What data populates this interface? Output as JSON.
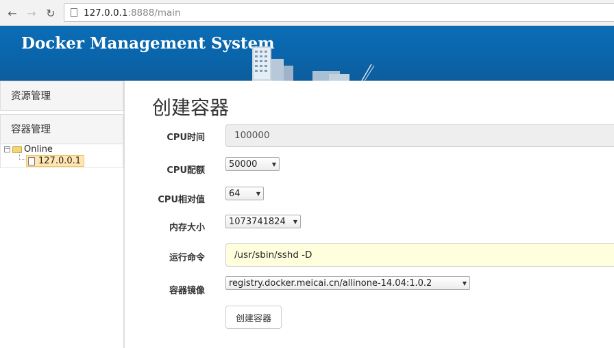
{
  "browser": {
    "url_host": "127.0.0.1",
    "url_rest": ":8888/main"
  },
  "banner": {
    "title": "Docker Management System"
  },
  "sidebar": {
    "sections": [
      {
        "label": "资源管理"
      },
      {
        "label": "容器管理"
      }
    ],
    "tree": {
      "root": "Online",
      "children": [
        "127.0.0.1"
      ]
    }
  },
  "main": {
    "title": "创建容器",
    "fields": {
      "cpu_time": {
        "label": "CPU时间",
        "value": "100000"
      },
      "cpu_quota": {
        "label": "CPU配额",
        "value": "50000"
      },
      "cpu_shares": {
        "label": "CPU相对值",
        "value": "64"
      },
      "memory": {
        "label": "内存大小",
        "value": "1073741824"
      },
      "command": {
        "label": "运行命令",
        "value": "/usr/sbin/sshd -D"
      },
      "image": {
        "label": "容器镜像",
        "value": "registry.docker.meicai.cn/allinone-14.04:1.0.2"
      }
    },
    "submit_label": "创建容器"
  },
  "colors": {
    "banner": "#0a64a9",
    "command_bg": "#ffffdd",
    "tree_selected": "#ffe6b0"
  }
}
